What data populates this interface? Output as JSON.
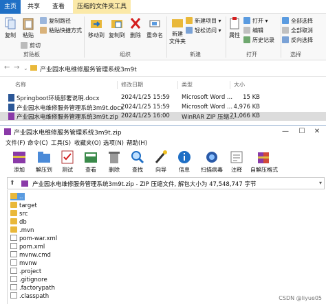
{
  "ribbon_tabs": [
    "主页",
    "共享",
    "查看",
    "压缩的文件夹工具"
  ],
  "ribbon": {
    "clipboard": {
      "copy": "复制",
      "paste": "粘贴",
      "copy_path": "复制路径",
      "paste_shortcut": "粘贴快捷方式",
      "cut": "剪切",
      "label": "剪贴板"
    },
    "organize": {
      "move_to": "移动到",
      "copy_to": "复制到",
      "delete": "删除",
      "rename": "重命名",
      "label": "组织"
    },
    "new": {
      "new_folder_line1": "新建",
      "new_folder_line2": "文件夹",
      "new_item": "新建项目 ▾",
      "easy_access": "轻松访问 ▾",
      "label": "新建"
    },
    "open": {
      "properties": "属性",
      "open": "打开 ▾",
      "edit": "编辑",
      "history": "历史记录",
      "label": "打开"
    },
    "select": {
      "select_all": "全部选择",
      "select_none": "全部取消",
      "invert": "反向选择",
      "label": "选择"
    }
  },
  "address": {
    "path": "产业园水电维修服务管理系统3m9t"
  },
  "columns": [
    "名称",
    "修改日期",
    "类型",
    "大小"
  ],
  "files": [
    {
      "name": "Springboot环境部署说明.docx",
      "date": "2024/1/25 15:59",
      "type": "Microsoft Word ...",
      "size": "15 KB"
    },
    {
      "name": "产业园水电维修服务管理系统3m9t.docx",
      "date": "2024/1/25 15:59",
      "type": "Microsoft Word ...",
      "size": "4,976 KB"
    },
    {
      "name": "产业园水电维修服务管理系统3m9t.zip",
      "date": "2024/1/25 16:00",
      "type": "WinRAR ZIP 压缩...",
      "size": "21,066 KB"
    }
  ],
  "rar": {
    "title": "产业园水电维修服务管理系统3m9t.zip",
    "menu": [
      "文件(F)",
      "命令(C)",
      "工具(S)",
      "收藏夹(O)",
      "选项(N)",
      "帮助(H)"
    ],
    "toolbar": [
      "添加",
      "解压到",
      "测试",
      "查看",
      "删除",
      "查找",
      "向导",
      "信息",
      "扫描病毒",
      "注释",
      "自解压格式"
    ],
    "path_text": "产业园水电维修服务管理系统3m9t.zip - ZIP 压缩文件, 解包大小为 47,548,747 字节",
    "items": [
      {
        "name": "..",
        "kind": "up"
      },
      {
        "name": "target",
        "kind": "folder"
      },
      {
        "name": "src",
        "kind": "folder"
      },
      {
        "name": "db",
        "kind": "folder"
      },
      {
        "name": ".mvn",
        "kind": "folder"
      },
      {
        "name": "pom-war.xml",
        "kind": "file"
      },
      {
        "name": "pom.xml",
        "kind": "file"
      },
      {
        "name": "mvnw.cmd",
        "kind": "file"
      },
      {
        "name": "mvnw",
        "kind": "file"
      },
      {
        "name": ".project",
        "kind": "file"
      },
      {
        "name": ".gitignore",
        "kind": "file"
      },
      {
        "name": ".factorypath",
        "kind": "file"
      },
      {
        "name": ".classpath",
        "kind": "file"
      }
    ]
  },
  "watermark": "CSDN @liyue05",
  "colors": {
    "accent": "#1f6fc5",
    "tool_tab": "#fbe9a8",
    "selected_row": "#dcdcdc",
    "folder": "#e9b83a"
  }
}
